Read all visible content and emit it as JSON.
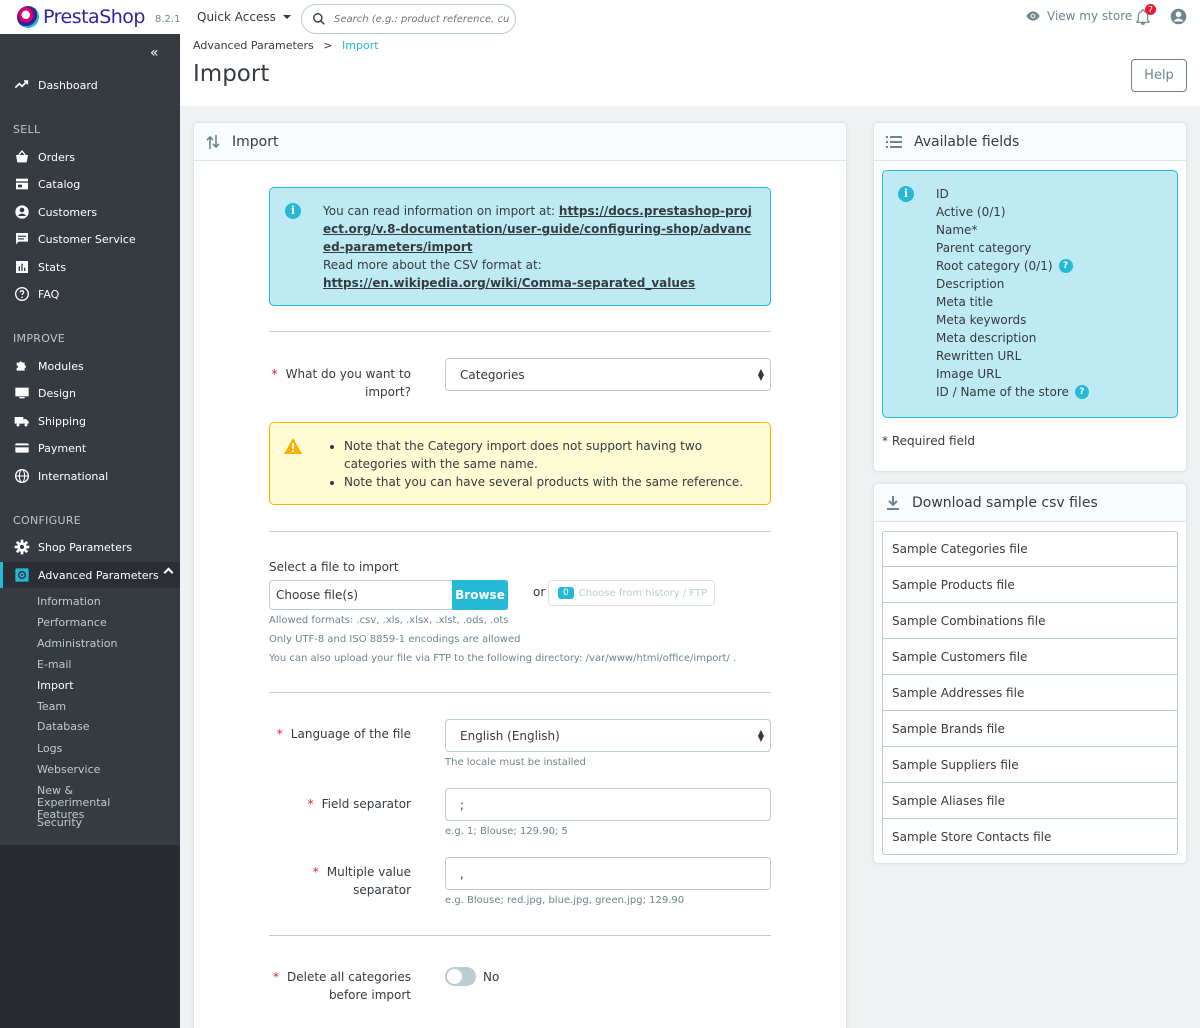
{
  "topbar": {
    "logo_text": "PrestaShop",
    "version": "8.2.1",
    "quick_access": "Quick Access",
    "search_placeholder": "Search (e.g.: product reference, custon",
    "view_store": "View my store",
    "notifications_count": "7"
  },
  "sidebar": {
    "items": [
      {
        "label": "Dashboard",
        "icon": "trending-up-icon"
      },
      {
        "section": "SELL"
      },
      {
        "label": "Orders",
        "icon": "basket-icon"
      },
      {
        "label": "Catalog",
        "icon": "store-icon"
      },
      {
        "label": "Customers",
        "icon": "account-circle-icon"
      },
      {
        "label": "Customer Service",
        "icon": "chat-icon"
      },
      {
        "label": "Stats",
        "icon": "bar-chart-icon"
      },
      {
        "label": "FAQ",
        "icon": "help-icon"
      },
      {
        "section": "IMPROVE"
      },
      {
        "label": "Modules",
        "icon": "puzzle-icon"
      },
      {
        "label": "Design",
        "icon": "desktop-icon"
      },
      {
        "label": "Shipping",
        "icon": "truck-icon"
      },
      {
        "label": "Payment",
        "icon": "credit-card-icon"
      },
      {
        "label": "International",
        "icon": "globe-icon"
      },
      {
        "section": "CONFIGURE"
      },
      {
        "label": "Shop Parameters",
        "icon": "settings-icon"
      },
      {
        "label": "Advanced Parameters",
        "icon": "settings-applications-icon"
      }
    ],
    "sub_items": [
      "Information",
      "Performance",
      "Administration",
      "E-mail",
      "Import",
      "Team",
      "Database",
      "Logs",
      "Webservice",
      "New & Experimental Features",
      "Security"
    ],
    "current_sub": "Import"
  },
  "header": {
    "breadcrumb_parent": "Advanced Parameters",
    "breadcrumb_sep": ">",
    "breadcrumb_current": "Import",
    "title": "Import",
    "help_label": "Help"
  },
  "import_card": {
    "title": "Import",
    "info_line1": "You can read information on import at:",
    "info_link1": "https://docs.prestashop-project.org/v.8-documentation/user-guide/configuring-shop/advanced-parameters/import",
    "info_line2": "Read more about the CSV format at:",
    "info_link2": "https://en.wikipedia.org/wiki/Comma-separated_values",
    "what_label": "What do you want to import?",
    "what_value": "Categories",
    "warning_1": "Note that the Category import does not support having two categories with the same name.",
    "warning_2": "Note that you can have several products with the same reference.",
    "select_file_label": "Select a file to import",
    "file_placeholder": "Choose file(s)",
    "browse_label": "Browse",
    "or_label": "or",
    "history_count": "0",
    "history_label": "Choose from history / FTP",
    "formats_hint": "Allowed formats: .csv, .xls, .xlsx, .xlst, .ods, .ots",
    "encoding_hint": "Only UTF-8 and ISO 8859-1 encodings are allowed",
    "ftp_hint": "You can also upload your file via FTP to the following directory: /var/www/html/office/import/ .",
    "language_label": "Language of the file",
    "language_value": "English (English)",
    "language_hint": "The locale must be installed",
    "field_sep_label": "Field separator",
    "field_sep_value": ";",
    "field_sep_hint": "e.g. 1; Blouse; 129.90; 5",
    "multi_sep_label": "Multiple value separator",
    "multi_sep_value": ",",
    "multi_sep_hint": "e.g. Blouse; red.jpg, blue.jpg, green.jpg; 129.90",
    "delete_label": "Delete all categories before import",
    "delete_value": "No"
  },
  "fields_card": {
    "title": "Available fields",
    "fields": [
      {
        "name": "ID",
        "help": false
      },
      {
        "name": "Active (0/1)",
        "help": false
      },
      {
        "name": "Name*",
        "help": false
      },
      {
        "name": "Parent category",
        "help": false
      },
      {
        "name": "Root category (0/1)",
        "help": true
      },
      {
        "name": "Description",
        "help": false
      },
      {
        "name": "Meta title",
        "help": false
      },
      {
        "name": "Meta keywords",
        "help": false
      },
      {
        "name": "Meta description",
        "help": false
      },
      {
        "name": "Rewritten URL",
        "help": false
      },
      {
        "name": "Image URL",
        "help": false
      },
      {
        "name": "ID / Name of the store",
        "help": true
      }
    ],
    "required_note": "* Required field"
  },
  "download_card": {
    "title": "Download sample csv files",
    "files": [
      "Sample Categories file",
      "Sample Products file",
      "Sample Combinations file",
      "Sample Customers file",
      "Sample Addresses file",
      "Sample Brands file",
      "Sample Suppliers file",
      "Sample Aliases file",
      "Sample Store Contacts file"
    ]
  }
}
